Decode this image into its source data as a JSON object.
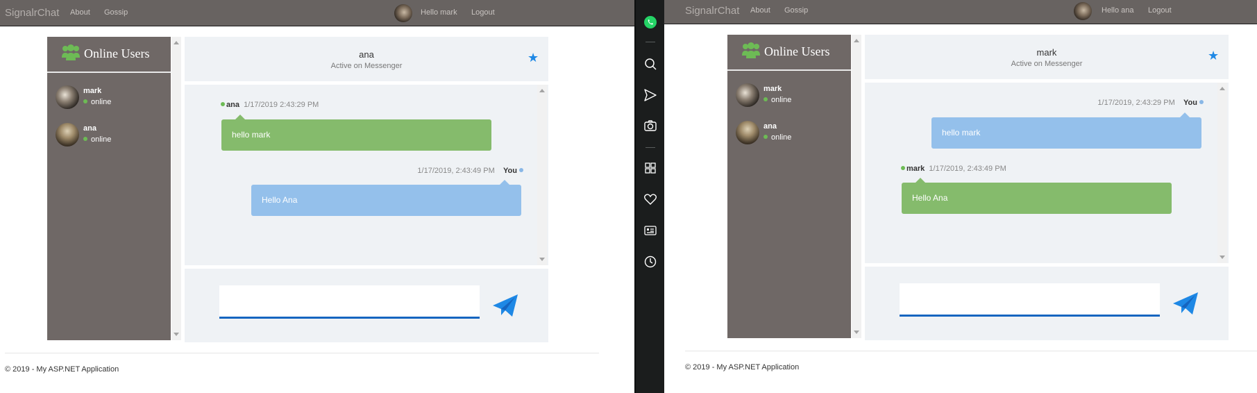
{
  "windows": [
    {
      "brand": "SignalrChat",
      "nav": {
        "about": "About",
        "gossip": "Gossip",
        "hello": "Hello mark",
        "logout": "Logout"
      },
      "sidebar_title": "Online Users",
      "users": [
        {
          "name": "mark",
          "status": "online"
        },
        {
          "name": "ana",
          "status": "online"
        }
      ],
      "chat_header": {
        "name": "ana",
        "subtitle": "Active on Messenger"
      },
      "messages": [
        {
          "sender": "ana",
          "timestamp": "1/17/2019 2:43:29 PM",
          "text": "hello mark"
        },
        {
          "sender": "You",
          "timestamp": "1/17/2019, 2:43:49 PM",
          "text": "Hello Ana"
        }
      ],
      "compose_placeholder": "",
      "footer": "© 2019 - My ASP.NET Application"
    },
    {
      "brand": "SignalrChat",
      "nav": {
        "about": "About",
        "gossip": "Gossip",
        "hello": "Hello ana",
        "logout": "Logout"
      },
      "sidebar_title": "Online Users",
      "users": [
        {
          "name": "mark",
          "status": "online"
        },
        {
          "name": "ana",
          "status": "online"
        }
      ],
      "chat_header": {
        "name": "mark",
        "subtitle": "Active on Messenger"
      },
      "messages": [
        {
          "sender": "You",
          "timestamp": "1/17/2019, 2:43:29 PM",
          "text": "hello mark"
        },
        {
          "sender": "mark",
          "timestamp": "1/17/2019, 2:43:49 PM",
          "text": "Hello Ana"
        }
      ],
      "compose_placeholder": "",
      "footer": "© 2019 - My ASP.NET Application"
    }
  ],
  "taskbar": {
    "icons": [
      "whatsapp-icon",
      "search-icon",
      "send-icon",
      "camera-icon",
      "apps-grid-icon",
      "heart-icon",
      "news-icon",
      "history-clock-icon"
    ]
  },
  "colors": {
    "navbar": "#686361",
    "sidebar": "#6f6866",
    "chat_background": "#eff2f5",
    "incoming_bubble": "#85bb6c",
    "outgoing_bubble": "#94c0eb",
    "accent_blue": "#1e88e5",
    "online_green": "#6dbb55",
    "taskbar": "#1b1d1d"
  }
}
